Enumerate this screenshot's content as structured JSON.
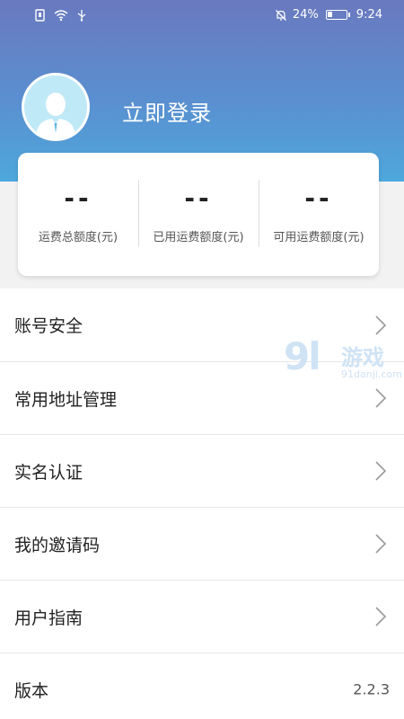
{
  "statusbar": {
    "battery": "24%",
    "time": "9:24",
    "icons": [
      "sim-icon",
      "wifi-icon",
      "usb-icon",
      "mute-icon",
      "battery-icon"
    ]
  },
  "profile": {
    "login_label": "立即登录",
    "avatar_icon": "user-avatar-icon"
  },
  "quota": [
    {
      "value": "--",
      "label": "运费总额度(元)"
    },
    {
      "value": "--",
      "label": "已用运费额度(元)"
    },
    {
      "value": "--",
      "label": "可用运费额度(元)"
    }
  ],
  "menu": {
    "items": [
      {
        "label": "账号安全"
      },
      {
        "label": "常用地址管理"
      },
      {
        "label": "实名认证"
      },
      {
        "label": "我的邀请码"
      },
      {
        "label": "用户指南"
      }
    ],
    "version_label": "版本",
    "version_value": "2.2.3"
  },
  "watermark": {
    "number": "9l",
    "cn": "游戏",
    "domain": "91danji.com"
  },
  "colors": {
    "header_top": "#6a79bf",
    "header_bottom": "#4ea8dc",
    "avatar_bg": "#bfe9f7"
  }
}
